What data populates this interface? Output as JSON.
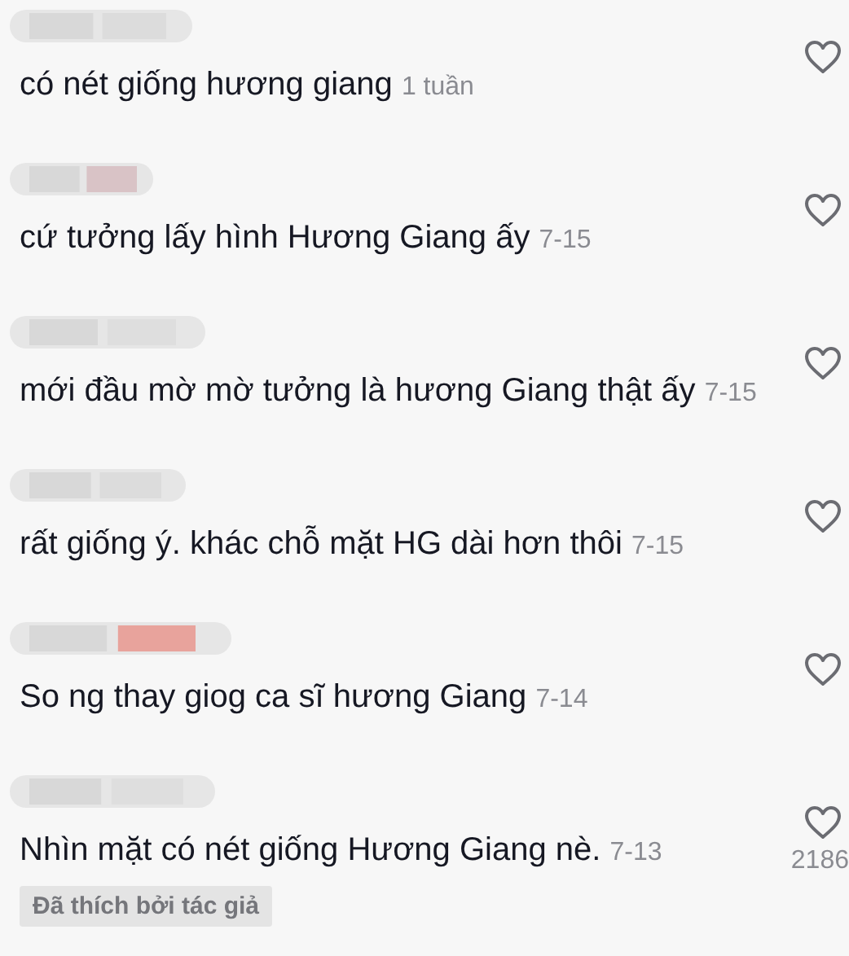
{
  "comments": [
    {
      "text": "có nét giống hương giang",
      "time": "1 tuần"
    },
    {
      "text": "cứ tưởng lấy hình Hương Giang ấy",
      "time": "7-15"
    },
    {
      "text": "mới đầu mờ mờ tưởng là hương Giang thật ấy",
      "time": "7-15"
    },
    {
      "text": "rất giống ý. khác chỗ mặt HG dài hơn thôi",
      "time": "7-15"
    },
    {
      "text": "So ng thay giog ca sĩ hương Giang",
      "time": "7-14"
    },
    {
      "text": "Nhìn mặt có nét giống Hương Giang nè.",
      "time": "7-13",
      "likes": "2186",
      "badge": "Đã thích bởi tác giả"
    }
  ]
}
